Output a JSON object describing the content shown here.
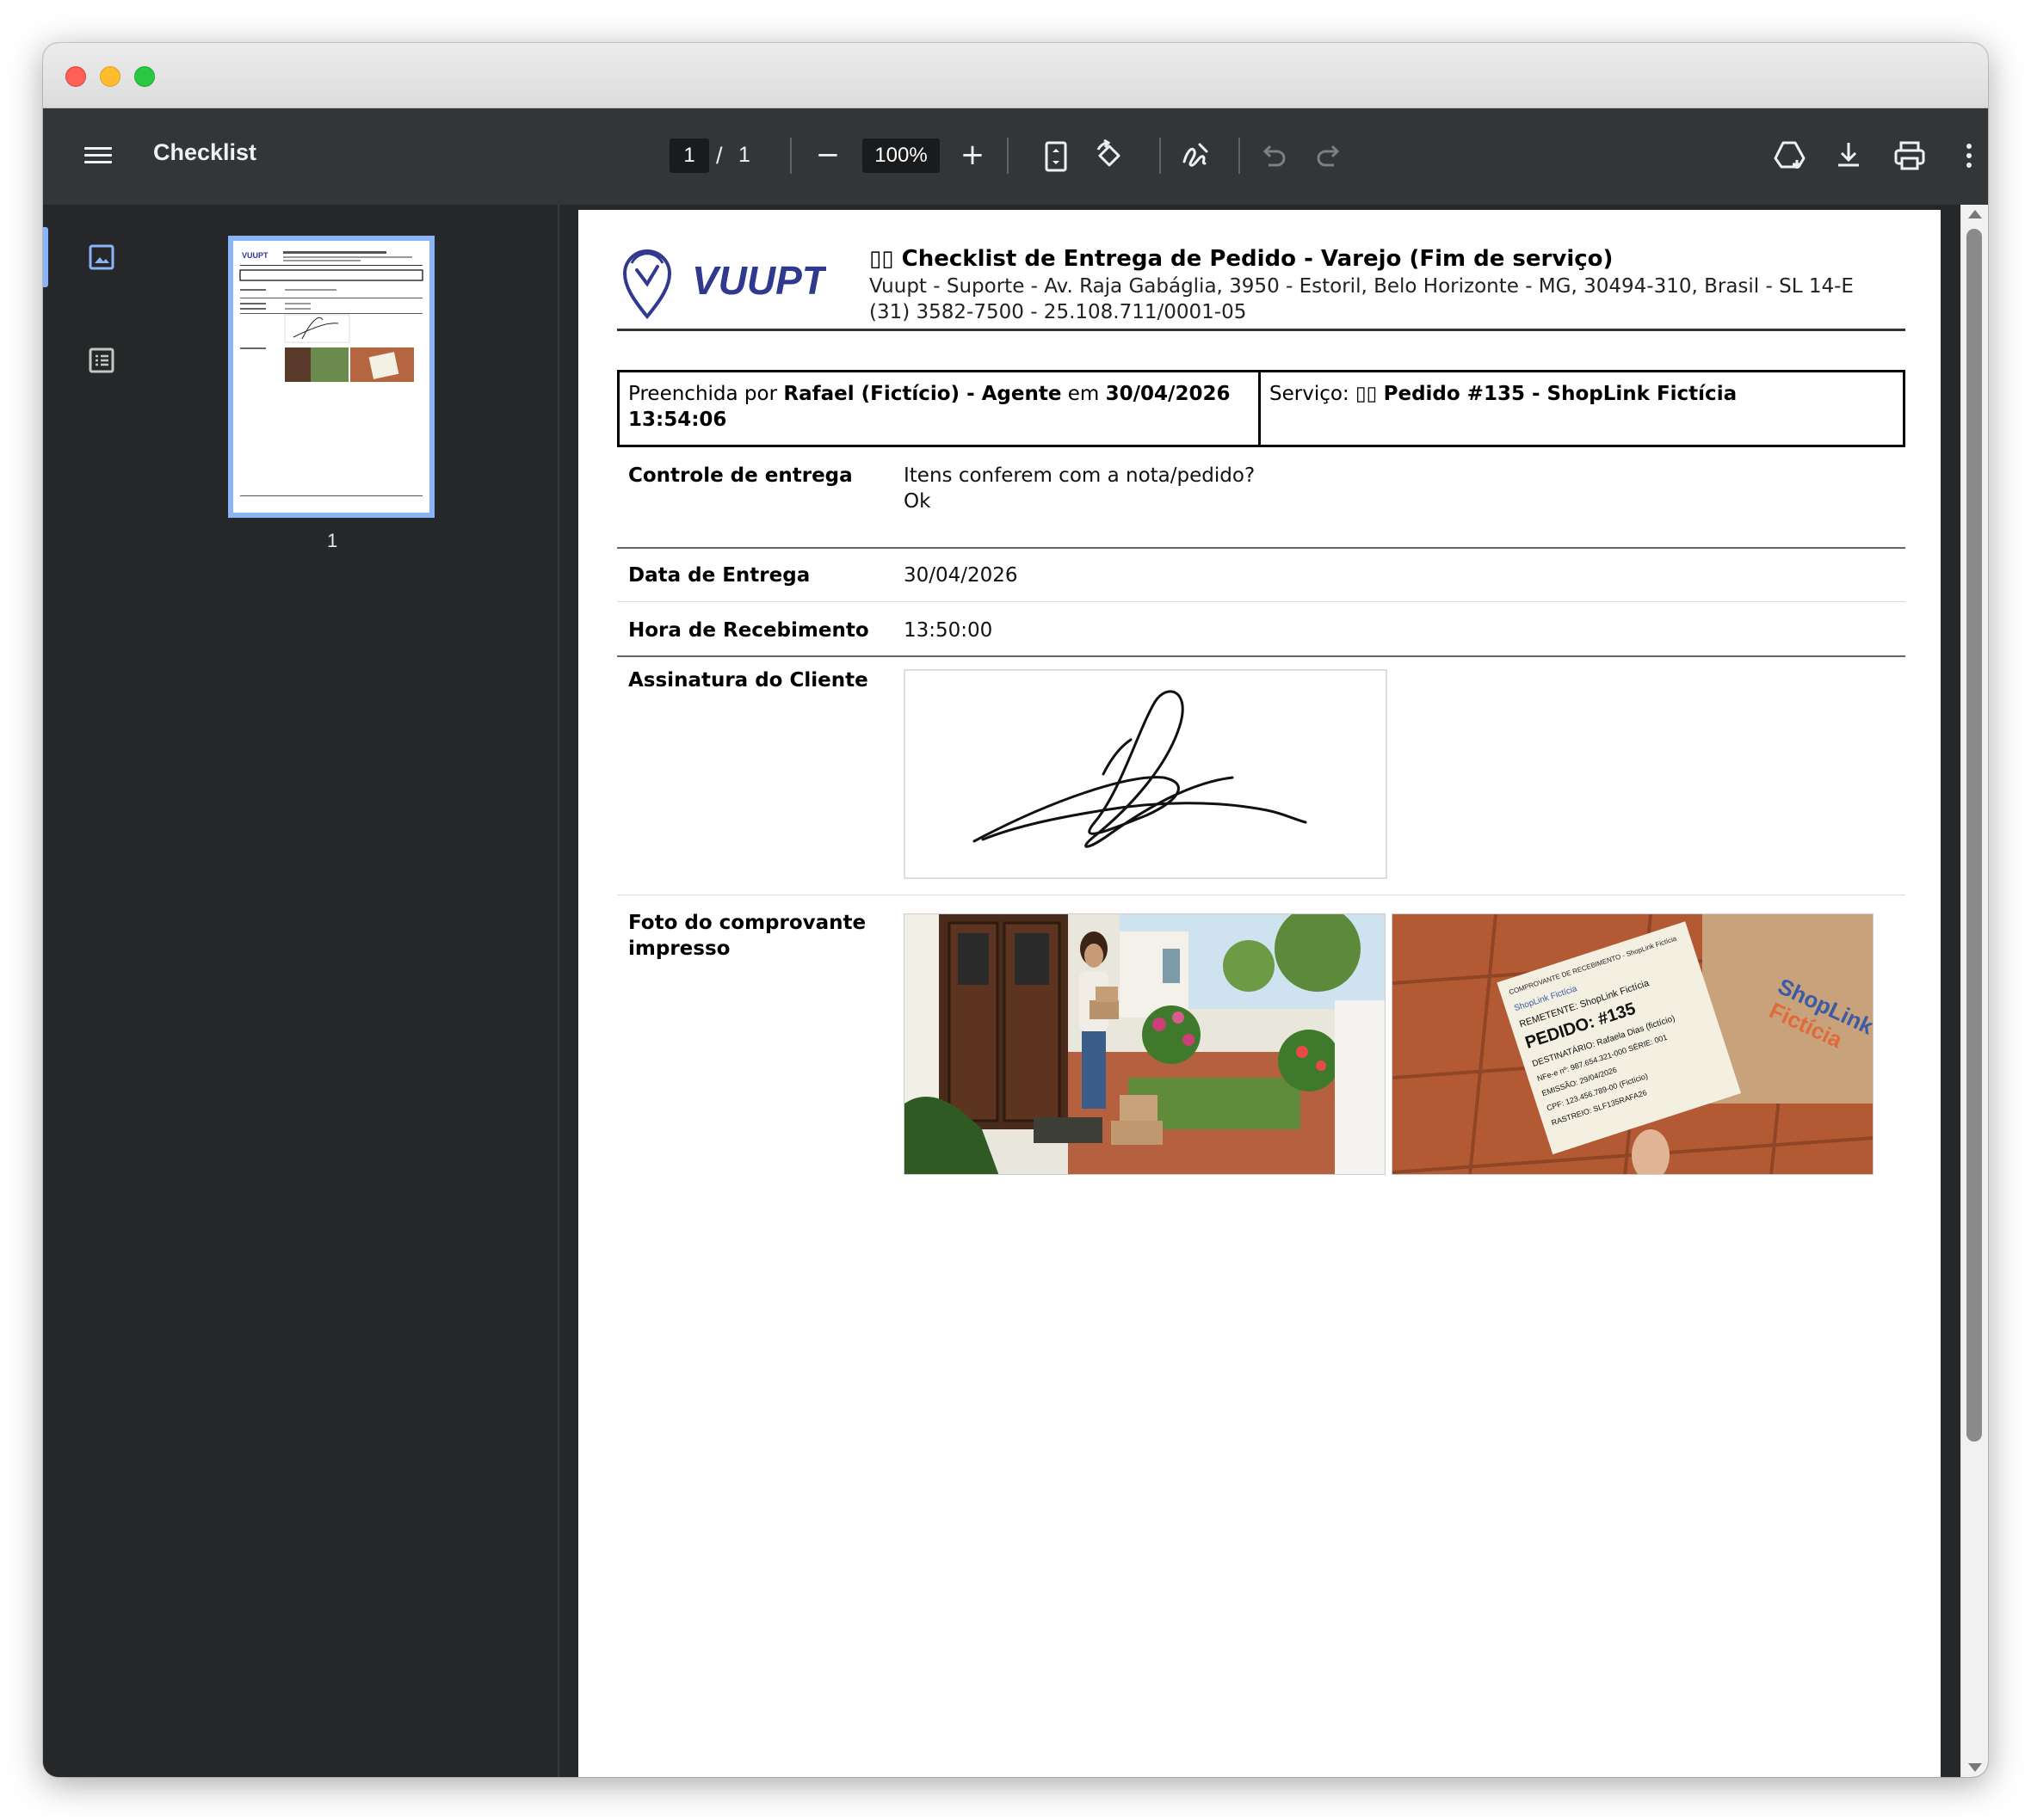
{
  "toolbar": {
    "title": "Checklist",
    "page_current": "1",
    "page_separator": "/",
    "page_total": "1",
    "zoom": "100%",
    "zoom_out_icon": "−",
    "zoom_in_icon": "+"
  },
  "sidebar": {
    "thumbnail_page_number": "1"
  },
  "document": {
    "logo_text": "VUUPT",
    "title": "▯▯ Checklist de Entrega de Pedido - Varejo (Fim de serviço)",
    "address": "Vuupt - Suporte - Av. Raja Gabáglia, 3950 - Estoril, Belo Horizonte - MG, 30494-310, Brasil - SL 14-E",
    "contact": "(31) 3582-7500 - 25.108.711/0001-05",
    "filled_prefix": "Preenchida por ",
    "filled_by": "Rafael (Fictício) - Agente",
    "filled_mid": " em ",
    "filled_date": "30/04/2026",
    "filled_time": "13:54:06",
    "service_prefix": "Serviço: ▯▯ ",
    "service_name": "Pedido #135 - ShopLink Fictícia",
    "rows": [
      {
        "label": "Controle de entrega",
        "value_line1": "Itens conferem com a nota/pedido?",
        "value_line2": "Ok"
      },
      {
        "label": "Data de Entrega",
        "value": "30/04/2026"
      },
      {
        "label": "Hora de Recebimento",
        "value": "13:50:00"
      },
      {
        "label": "Assinatura do Cliente"
      },
      {
        "label_line1": "Foto do comprovante",
        "label_line2": "impresso"
      }
    ],
    "receipt": {
      "header": "COMPROVANTE DE RECEBIMENTO - ShopLink Fictícia",
      "brand": "ShopLink Fictícia",
      "sender": "REMETENTE: ShopLink Fictícia",
      "order": "PEDIDO: #135",
      "recipient": "DESTINATÁRIO: Rafaela Dias (fictício)",
      "nfe": "NFe-e nº: 987.654.321-000  SÉRIE: 001",
      "emission": "EMISSÃO: 29/04/2026",
      "cpf": "CPF: 123.456.789-00 (Fictício)",
      "tracking": "RASTREIO: SLF135RAFA26",
      "box_brand_1": "ShopLink",
      "box_brand_2": "Fictícia"
    }
  },
  "colors": {
    "toolbar_bg": "#323639",
    "sidebar_bg": "#262729",
    "accent": "#8ab4f8",
    "logo_blue": "#2f3a8f"
  }
}
